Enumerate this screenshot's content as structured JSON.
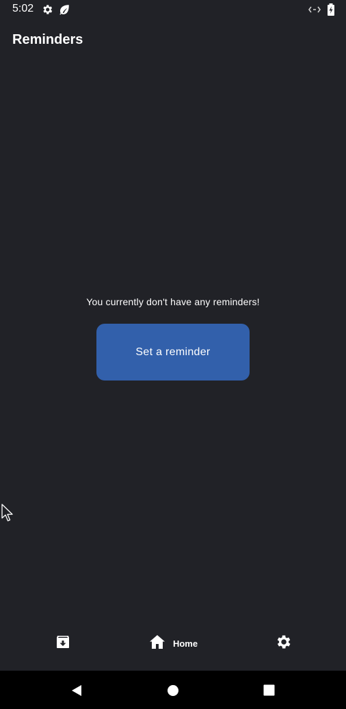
{
  "status_bar": {
    "time": "5:02",
    "icons_left": [
      "settings-gear-icon",
      "leaf-icon"
    ],
    "icons_right": [
      "data-arrows-icon",
      "battery-charging-icon"
    ]
  },
  "app_bar": {
    "title": "Reminders"
  },
  "empty_state": {
    "message": "You currently don't have any reminders!",
    "button_label": "Set a reminder"
  },
  "bottom_nav": {
    "items": [
      {
        "icon": "archive-icon",
        "label": ""
      },
      {
        "icon": "home-icon",
        "label": "Home",
        "selected": true
      },
      {
        "icon": "settings-icon",
        "label": ""
      }
    ]
  },
  "system_nav": {
    "buttons": [
      "back-icon",
      "home-circle-icon",
      "recents-square-icon"
    ]
  },
  "colors": {
    "background": "#212227",
    "accent_button": "#3260AB",
    "text": "#FFFFFF",
    "system_nav_bg": "#000000"
  }
}
